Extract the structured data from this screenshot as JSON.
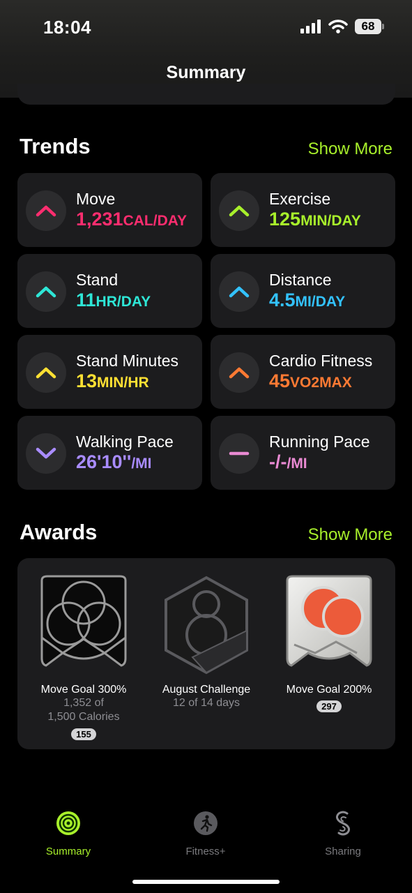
{
  "status": {
    "time": "18:04",
    "battery": "68"
  },
  "nav": {
    "title": "Summary"
  },
  "trends": {
    "title": "Trends",
    "show_more": "Show More",
    "items": [
      {
        "label": "Move",
        "value": "1,231",
        "unit": "CAL/DAY",
        "color": "#ff2d6f",
        "direction": "up"
      },
      {
        "label": "Exercise",
        "value": "125",
        "unit": "MIN/DAY",
        "color": "#a8f02b",
        "direction": "up"
      },
      {
        "label": "Stand",
        "value": "11",
        "unit": "HR/DAY",
        "color": "#2ee6d6",
        "direction": "up"
      },
      {
        "label": "Distance",
        "value": "4.5",
        "unit": "MI/DAY",
        "color": "#33c2ff",
        "direction": "up"
      },
      {
        "label": "Stand Minutes",
        "value": "13",
        "unit": "MIN/HR",
        "color": "#ffe033",
        "direction": "up"
      },
      {
        "label": "Cardio Fitness",
        "value": "45",
        "unit": "VO2MAX",
        "color": "#ff7a33",
        "direction": "up"
      },
      {
        "label": "Walking Pace",
        "value": "26'10''",
        "unit": "/MI",
        "color": "#a98cff",
        "direction": "down"
      },
      {
        "label": "Running Pace",
        "value": "-/-",
        "unit": "/MI",
        "color": "#e98ad2",
        "direction": "flat"
      }
    ]
  },
  "awards": {
    "title": "Awards",
    "show_more": "Show More",
    "items": [
      {
        "title": "Move Goal 300%",
        "sub1": "1,352 of",
        "sub2": "1,500 Calories",
        "count": "155",
        "badge_text": "300"
      },
      {
        "title": "August Challenge",
        "sub1": "12 of 14 days",
        "sub2": "",
        "count": "",
        "badge_text": "8"
      },
      {
        "title": "Move Goal 200%",
        "sub1": "",
        "sub2": "",
        "count": "297",
        "badge_text": "200"
      }
    ]
  },
  "tabbar": {
    "items": [
      {
        "label": "Summary",
        "icon": "activity-rings-icon",
        "active": true
      },
      {
        "label": "Fitness+",
        "icon": "runner-icon",
        "active": false
      },
      {
        "label": "Sharing",
        "icon": "sharing-icon",
        "active": false
      }
    ]
  }
}
